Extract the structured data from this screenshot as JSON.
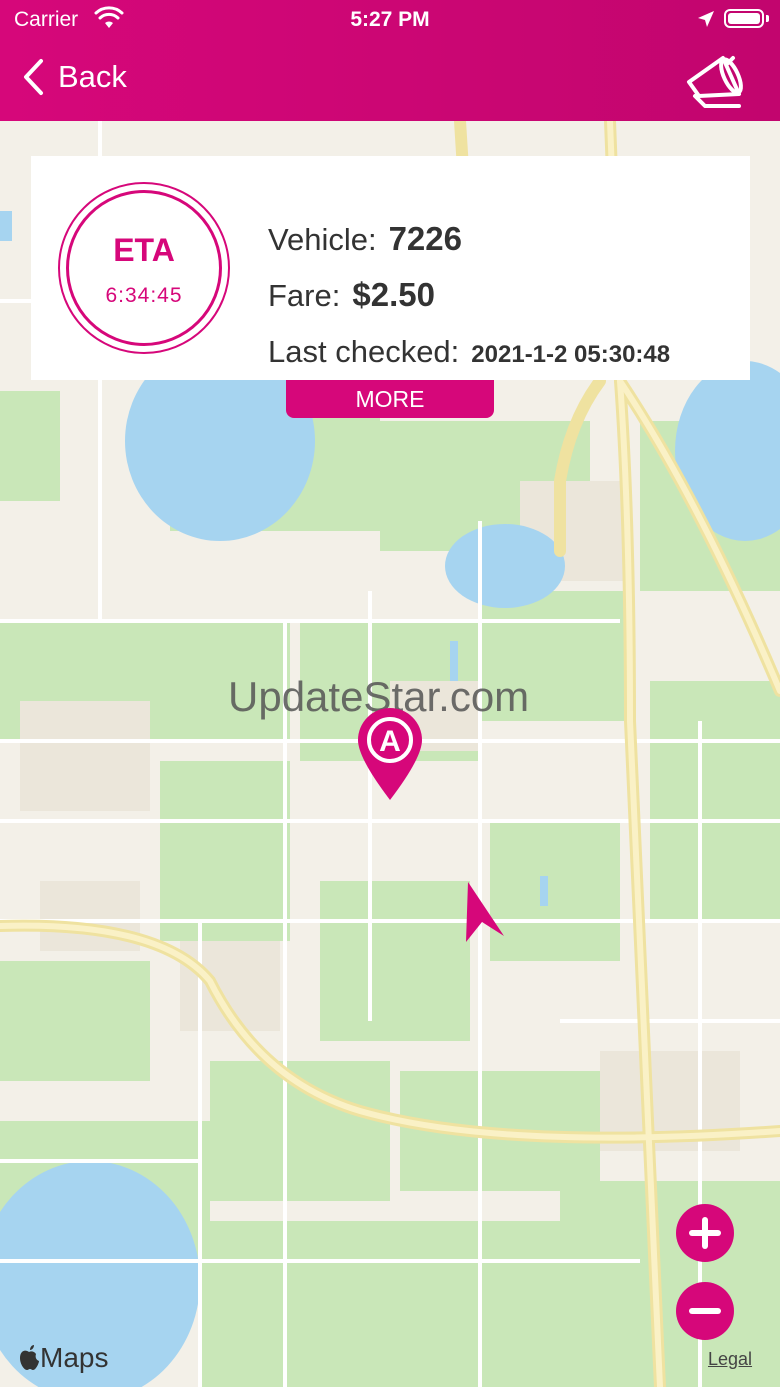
{
  "status_bar": {
    "carrier": "Carrier",
    "time": "5:27 PM"
  },
  "nav": {
    "back_label": "Back",
    "icons": [
      "back-chevron-icon",
      "megaphone-icon"
    ]
  },
  "trip": {
    "eta_label": "ETA",
    "eta_time": "6:34:45",
    "vehicle_label": "Vehicle:",
    "vehicle_value": "7226",
    "fare_label": "Fare:",
    "fare_value": "$2.50",
    "last_checked_label": "Last checked:",
    "last_checked_value": "2021-1-2 05:30:48",
    "more_label": "MORE"
  },
  "map": {
    "watermark": "UpdateStar.com",
    "pin_label": "A",
    "maps_brand": "Maps",
    "legal_label": "Legal",
    "zoom_icons": [
      "zoom-in-icon",
      "zoom-out-icon"
    ]
  },
  "colors": {
    "accent": "#d6077a",
    "water": "#a6d4f0",
    "park": "#c9e7b8",
    "road": "#f7e9a6"
  }
}
